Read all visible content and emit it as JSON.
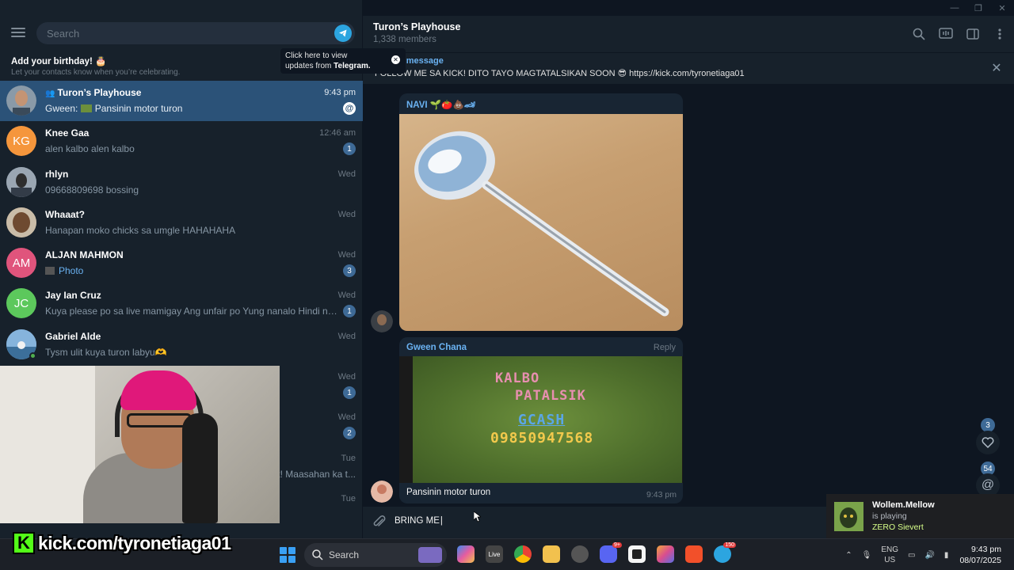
{
  "window": {
    "minimize": "—",
    "maximize": "❐",
    "close": "✕"
  },
  "sidebar": {
    "search_placeholder": "Search",
    "birthday_title": "Add your birthday! 🎂",
    "birthday_sub": "Let your contacts know when you’re celebrating.",
    "tooltip_line1": "Click here to view",
    "tooltip_line2": "updates from ",
    "tooltip_bold": "Telegram."
  },
  "chats": [
    {
      "name": "Turon’s Playhouse",
      "time": "9:43 pm",
      "preview_sender": "Gween: ",
      "preview": "Pansinin motor turon",
      "mention": "@",
      "avatar_color": "#5a6f80"
    },
    {
      "name": "Knee Gaa",
      "time": "12:46 am",
      "preview": "alen kalbo alen kalbo",
      "badge": "1",
      "initials": "KG",
      "avatar_color": "#f5963c"
    },
    {
      "name": "rhlyn",
      "time": "Wed",
      "preview": "09668809698 bossing",
      "avatar_color": "#6b7a8a"
    },
    {
      "name": "Whaaat?",
      "time": "Wed",
      "preview": "Hanapan moko chicks sa umgle HAHAHAHA",
      "avatar_color": "#8a6e4e"
    },
    {
      "name": "ALJAN MAHMON",
      "time": "Wed",
      "preview": "Photo",
      "badge": "3",
      "initials": "AM",
      "avatar_color": "#e0547c"
    },
    {
      "name": "Jay Ian Cruz",
      "time": "Wed",
      "preview": "Kuya please po sa live mamigay Ang unfair po Yung nanalo Hindi nanun...",
      "badge": "1",
      "initials": "JC",
      "avatar_color": "#5cc85c"
    },
    {
      "name": "Gabriel Alde",
      "time": "Wed",
      "preview": "Tysm ulit kuya turon labyu🫶",
      "avatar_color": "#4a7aa8"
    },
    {
      "name": "",
      "time": "Wed",
      "preview": "",
      "badge": "1"
    },
    {
      "name": "",
      "time": "Wed",
      "preview": "",
      "badge": "2"
    },
    {
      "name": "",
      "time": "Tue",
      "preview": "at! Maasahan ka t..."
    },
    {
      "name": "",
      "time": "Tue",
      "preview": ""
    }
  ],
  "header": {
    "title": "Turon’s Playhouse",
    "members": "1,338 members",
    "icons": [
      "search-icon",
      "voice-chat-icon",
      "sidebar-toggle-icon",
      "more-icon"
    ]
  },
  "pinned": {
    "label": "Pinned message",
    "text": "FOLLOW ME SA KICK! DITO TAYO MAGTATALSIKAN SOON 😎 https://kick.com/tyronetiaga01"
  },
  "messages": [
    {
      "sender": "NAVI 🌱🍅💩🏎",
      "sender_color": "#6ab2f2"
    },
    {
      "sender": "Gween Chana",
      "sender_color": "#6ab2f2",
      "reply": "Reply",
      "caption": "Pansinin motor turon",
      "time": "9:43 pm",
      "game_lines": [
        "KALBO",
        "PATALSIK",
        "GCASH",
        "09850947568"
      ]
    }
  ],
  "floating": {
    "reactions_count": "3",
    "mentions_count": "54"
  },
  "compose": {
    "text": "BRING ME"
  },
  "toast": {
    "name": "Wollem.Mellow",
    "status": "is playing",
    "game": "ZERO Sievert"
  },
  "kick_overlay": {
    "logo": "K",
    "text": "kick.com/tyronetiaga01"
  },
  "taskbar": {
    "search": "Search",
    "apps": [
      {
        "name": "widgets",
        "color": "#6a5acd"
      },
      {
        "name": "copilot",
        "color": "#e65ca0"
      },
      {
        "name": "live",
        "color": "#444",
        "label": "Live"
      },
      {
        "name": "chrome",
        "color": "#e0a52b"
      },
      {
        "name": "file-explorer",
        "color": "#f2c14e"
      },
      {
        "name": "chrome-dev",
        "color": "#555"
      },
      {
        "name": "discord",
        "color": "#5865f2",
        "badge": "9+"
      },
      {
        "name": "app-square",
        "color": "#2d2d2d"
      },
      {
        "name": "gallery",
        "color": "#d94d8f"
      },
      {
        "name": "brave",
        "color": "#f2502a"
      },
      {
        "name": "telegram",
        "color": "#2ca5e0",
        "badge": "150"
      }
    ],
    "lang_top": "ENG",
    "lang_bottom": "US",
    "time": "9:43 pm",
    "date": "08/07/2025"
  }
}
